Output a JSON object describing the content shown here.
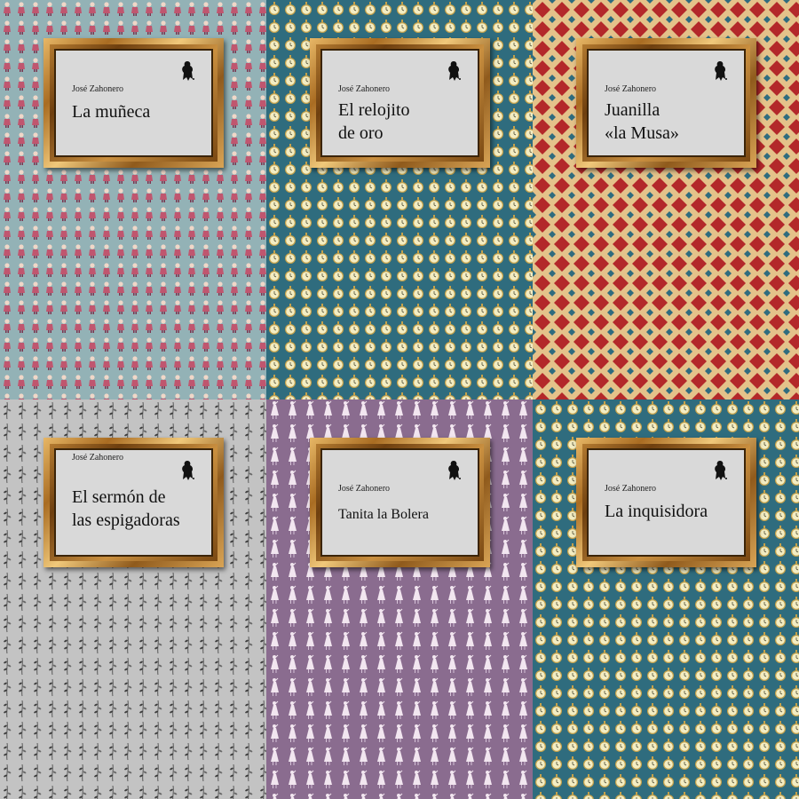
{
  "covers": [
    {
      "author": "José Zahonero",
      "title_line1": "La muñeca",
      "title_line2": "",
      "background": "#93b2b6",
      "pattern": "doll",
      "pattern_colors": [
        "#c0566f",
        "#f0d7c8",
        "#7a3550"
      ]
    },
    {
      "author": "José Zahonero",
      "title_line1": "El relojito",
      "title_line2": "de oro",
      "background": "#2f6c7e",
      "pattern": "clock",
      "pattern_colors": [
        "#f3edc3",
        "#c6a24a",
        "#4d4a33"
      ]
    },
    {
      "author": "José Zahonero",
      "title_line1": "Juanilla",
      "title_line2": "«la Musa»",
      "background": "#b3282a",
      "pattern": "lattice",
      "pattern_colors": [
        "#2f6c7e",
        "#e4c28a",
        "#b3282a"
      ]
    },
    {
      "author": "José Zahonero",
      "title_line1": "El sermón de",
      "title_line2": "las espigadoras",
      "background": "#c3c3c3",
      "pattern": "sprig",
      "pattern_colors": [
        "#3f3f3f",
        "#6a6a6a"
      ]
    },
    {
      "author": "José Zahonero",
      "title_line1": "Tanita la Bolera",
      "title_line2": "",
      "background": "#8a6c8f",
      "pattern": "dancer",
      "pattern_colors": [
        "#f2e6f0",
        "#d7c4d9"
      ]
    },
    {
      "author": "José Zahonero",
      "title_line1": "La inquisidora",
      "title_line2": "",
      "background": "#2f6c7e",
      "pattern": "clock",
      "pattern_colors": [
        "#f3edc3",
        "#c6a24a",
        "#4d4a33"
      ]
    }
  ],
  "logo_icon": "crowned-figure-logo-icon"
}
